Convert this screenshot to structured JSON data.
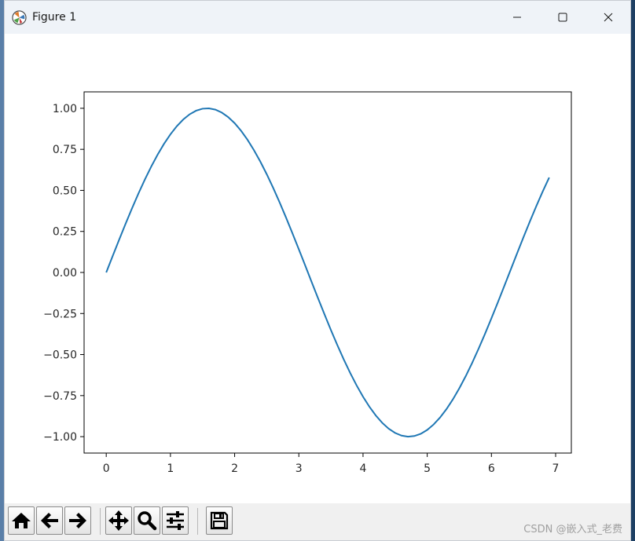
{
  "window": {
    "title": "Figure 1",
    "minimize_icon": "minimize-icon",
    "maximize_icon": "maximize-icon",
    "close_icon": "close-icon"
  },
  "toolbar": {
    "buttons": [
      {
        "name": "home",
        "icon": "home-icon"
      },
      {
        "name": "back",
        "icon": "arrow-left-icon"
      },
      {
        "name": "forward",
        "icon": "arrow-right-icon"
      },
      {
        "name": "pan",
        "icon": "move-icon"
      },
      {
        "name": "zoom",
        "icon": "magnifier-icon"
      },
      {
        "name": "configure-subplots",
        "icon": "sliders-icon"
      },
      {
        "name": "save",
        "icon": "floppy-icon"
      }
    ]
  },
  "watermark": "CSDN @嵌入式_老费",
  "chart_data": {
    "type": "line",
    "title": "",
    "xlabel": "",
    "ylabel": "",
    "xlim": [
      -0.345,
      7.245
    ],
    "ylim": [
      -1.1,
      1.1
    ],
    "xticks": [
      0,
      1,
      2,
      3,
      4,
      5,
      6,
      7
    ],
    "xtick_labels": [
      "0",
      "1",
      "2",
      "3",
      "4",
      "5",
      "6",
      "7"
    ],
    "yticks": [
      -1.0,
      -0.75,
      -0.5,
      -0.25,
      0.0,
      0.25,
      0.5,
      0.75,
      1.0
    ],
    "ytick_labels": [
      "−1.00",
      "−0.75",
      "−0.50",
      "−0.25",
      "0.00",
      "0.25",
      "0.50",
      "0.75",
      "1.00"
    ],
    "grid": false,
    "color": "#1f77b4",
    "series": [
      {
        "x": [
          0.0,
          0.1,
          0.2,
          0.3,
          0.4,
          0.5,
          0.6,
          0.7,
          0.8,
          0.9,
          1.0,
          1.1,
          1.2,
          1.3,
          1.4,
          1.5,
          1.6,
          1.7,
          1.8,
          1.9,
          2.0,
          2.1,
          2.2,
          2.3,
          2.4,
          2.5,
          2.6,
          2.7,
          2.8,
          2.9,
          3.0,
          3.1,
          3.2,
          3.3,
          3.4,
          3.5,
          3.6,
          3.7,
          3.8,
          3.9,
          4.0,
          4.1,
          4.2,
          4.3,
          4.4,
          4.5,
          4.6,
          4.7,
          4.8,
          4.9,
          5.0,
          5.1,
          5.2,
          5.3,
          5.4,
          5.5,
          5.6,
          5.7,
          5.8,
          5.9,
          6.0,
          6.1,
          6.2,
          6.3,
          6.4,
          6.5,
          6.6,
          6.7,
          6.8,
          6.9
        ],
        "y": [
          0.0,
          0.0998,
          0.1987,
          0.2955,
          0.3894,
          0.4794,
          0.5646,
          0.6442,
          0.7174,
          0.7833,
          0.8415,
          0.8912,
          0.932,
          0.9636,
          0.9854,
          0.9975,
          0.9996,
          0.9917,
          0.9738,
          0.9463,
          0.9093,
          0.8632,
          0.8085,
          0.7457,
          0.6755,
          0.5985,
          0.5155,
          0.4274,
          0.335,
          0.2392,
          0.1411,
          0.0416,
          -0.0584,
          -0.1577,
          -0.2555,
          -0.3508,
          -0.4425,
          -0.5298,
          -0.6119,
          -0.6878,
          -0.7568,
          -0.8183,
          -0.8716,
          -0.9162,
          -0.9516,
          -0.9775,
          -0.9937,
          -0.9999,
          -0.9962,
          -0.9825,
          -0.9589,
          -0.9258,
          -0.8835,
          -0.8323,
          -0.7728,
          -0.7055,
          -0.6313,
          -0.5507,
          -0.4646,
          -0.3739,
          -0.2794,
          -0.1822,
          -0.0831,
          0.0168,
          0.1165,
          0.2151,
          0.3115,
          0.4048,
          0.4941,
          0.5784
        ]
      }
    ]
  }
}
